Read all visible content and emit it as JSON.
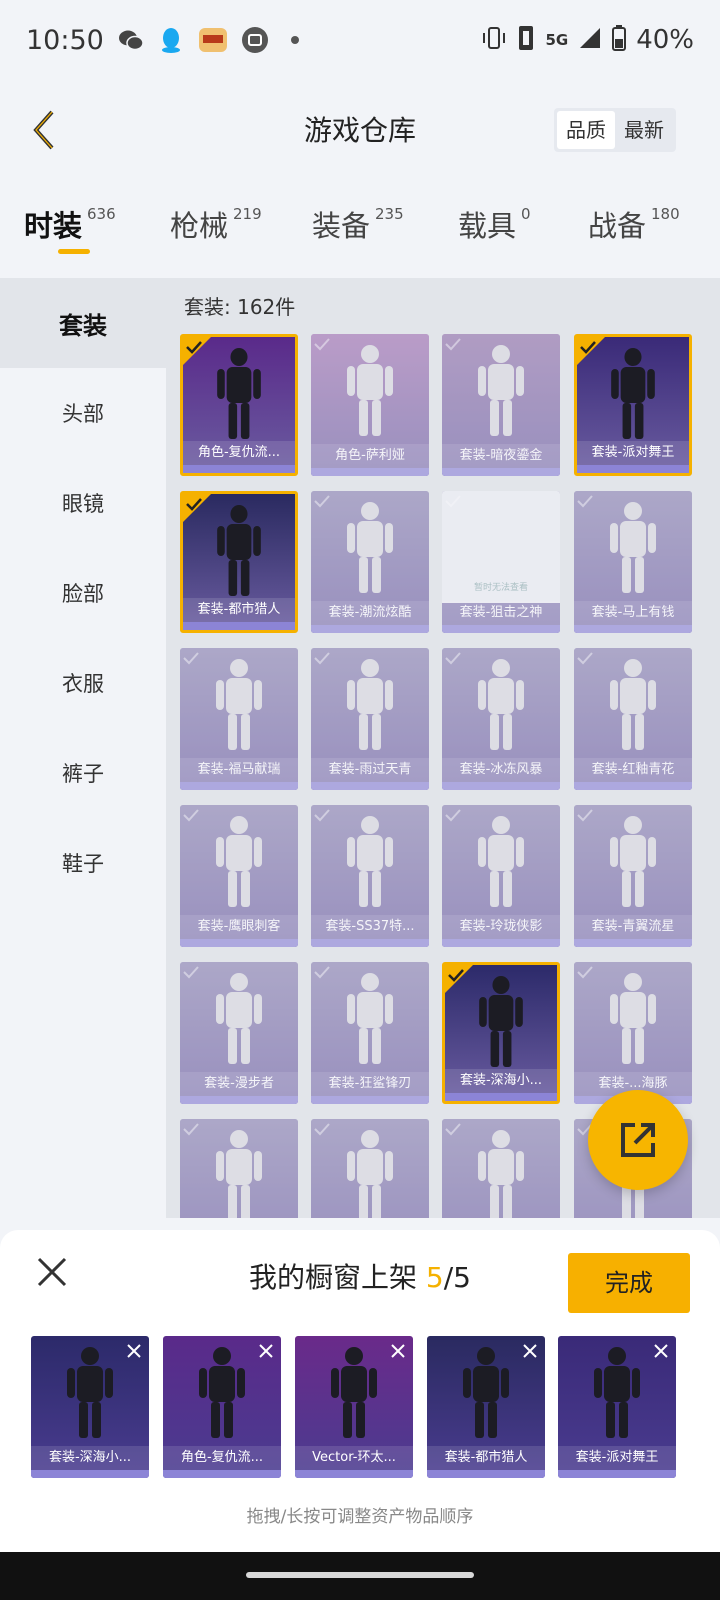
{
  "status_bar": {
    "time": "10:50",
    "network": "5G",
    "battery": "40%",
    "icons": [
      "wechat-icon",
      "qq-icon",
      "app-badge-icon",
      "calendar-icon",
      "dot-icon",
      "vibrate-icon",
      "sim-icon",
      "signal-icon",
      "battery-icon"
    ]
  },
  "header": {
    "title": "游戏仓库",
    "sort_options": [
      "品质",
      "最新"
    ],
    "active_sort": "品质"
  },
  "tabs": [
    {
      "label": "时装",
      "count": "636",
      "active": true
    },
    {
      "label": "枪械",
      "count": "219",
      "active": false
    },
    {
      "label": "装备",
      "count": "235",
      "active": false
    },
    {
      "label": "载具",
      "count": "0",
      "active": false
    },
    {
      "label": "战备",
      "count": "180",
      "active": false
    }
  ],
  "sidebar": {
    "items": [
      {
        "label": "套装",
        "active": true
      },
      {
        "label": "头部",
        "active": false
      },
      {
        "label": "眼镜",
        "active": false
      },
      {
        "label": "脸部",
        "active": false
      },
      {
        "label": "衣服",
        "active": false
      },
      {
        "label": "裤子",
        "active": false
      },
      {
        "label": "鞋子",
        "active": false
      }
    ]
  },
  "content": {
    "title": "套装: 162件",
    "items": [
      {
        "label": "角色-复仇流...",
        "selected": true,
        "bg": "#5a2a8a"
      },
      {
        "label": "角色-萨利娅",
        "selected": false,
        "bg": "#a070b0"
      },
      {
        "label": "套装-暗夜鎏金",
        "selected": false,
        "bg": "#9070a8"
      },
      {
        "label": "套装-派对舞王",
        "selected": true,
        "bg": "#3a2a78"
      },
      {
        "label": "套装-都市猎人",
        "selected": true,
        "bg": "#2a2a60"
      },
      {
        "label": "套装-潮流炫酷",
        "selected": false,
        "bg": "#8a82b0"
      },
      {
        "label": "套装-狙击之神",
        "selected": false,
        "bg": "#8a82b0",
        "placeholder": "暂时无法查看"
      },
      {
        "label": "套装-马上有钱",
        "selected": false,
        "bg": "#8a82b0"
      },
      {
        "label": "套装-福马献瑞",
        "selected": false,
        "bg": "#8a82b0"
      },
      {
        "label": "套装-雨过天青",
        "selected": false,
        "bg": "#8a82b0"
      },
      {
        "label": "套装-冰冻风暴",
        "selected": false,
        "bg": "#8a82b0"
      },
      {
        "label": "套装-红釉青花",
        "selected": false,
        "bg": "#8a82b0"
      },
      {
        "label": "套装-鹰眼刺客",
        "selected": false,
        "bg": "#8a82b0"
      },
      {
        "label": "套装-SS37特...",
        "selected": false,
        "bg": "#8a82b0"
      },
      {
        "label": "套装-玲珑侠影",
        "selected": false,
        "bg": "#8a82b0"
      },
      {
        "label": "套装-青翼流星",
        "selected": false,
        "bg": "#8a82b0"
      },
      {
        "label": "套装-漫步者",
        "selected": false,
        "bg": "#8a82b0"
      },
      {
        "label": "套装-狂鲨锋刃",
        "selected": false,
        "bg": "#8a82b0"
      },
      {
        "label": "套装-深海小...",
        "selected": true,
        "bg": "#2c2a6a"
      },
      {
        "label": "套装-...海豚",
        "selected": false,
        "bg": "#8a82b0"
      },
      {
        "label": "",
        "selected": false,
        "bg": "#8a82b0"
      },
      {
        "label": "",
        "selected": false,
        "bg": "#8a82b0"
      },
      {
        "label": "",
        "selected": false,
        "bg": "#8a82b0"
      },
      {
        "label": "",
        "selected": false,
        "bg": "#8a82b0"
      }
    ]
  },
  "panel": {
    "title_prefix": "我的橱窗上架 ",
    "count": "5",
    "total": "/5",
    "done_label": "完成",
    "hint": "拖拽/长按可调整资产物品顺序",
    "slots": [
      {
        "label": "套装-深海小...",
        "bg": "#2c2a6a"
      },
      {
        "label": "角色-复仇流...",
        "bg": "#5a2a8a"
      },
      {
        "label": "Vector-环太...",
        "bg": "#6a2a8a"
      },
      {
        "label": "套装-都市猎人",
        "bg": "#2a2a60"
      },
      {
        "label": "套装-派对舞王",
        "bg": "#3a2a78"
      }
    ]
  },
  "colors": {
    "accent": "#f5b100",
    "card_strip": "#8c84d6",
    "background": "#f2f4f8"
  }
}
